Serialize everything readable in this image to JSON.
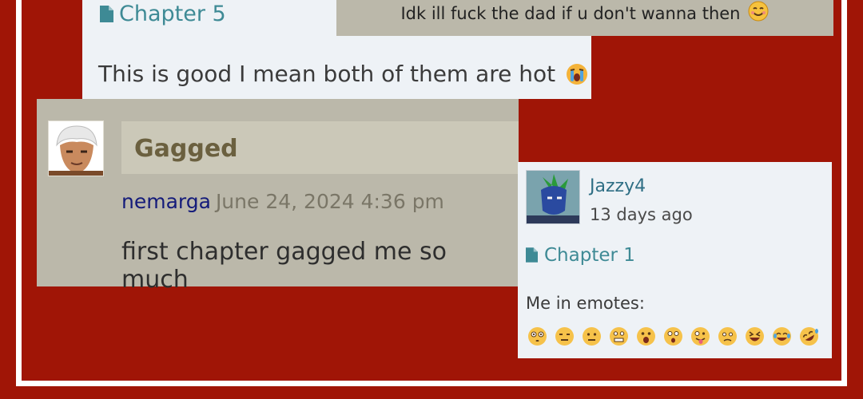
{
  "card_top_left": {
    "chapter_label": "Chapter 5",
    "comment": "This is good I mean both of them are hot",
    "emoji": "loudly-crying-face"
  },
  "card_top_right": {
    "comment": "Idk ill fuck the dad if u don't wanna then",
    "emoji": "smiling-face"
  },
  "card_middle": {
    "title": "Gagged",
    "author": "nemarga",
    "date": "June 24, 2024 4:36 pm",
    "comment": "first chapter gagged me so much"
  },
  "card_right": {
    "username": "Jazzy4",
    "time_ago": "13 days ago",
    "chapter_label": "Chapter 1",
    "comment": "Me in emotes:",
    "emotes": [
      "flushed",
      "expressionless",
      "neutral",
      "grimacing",
      "astonished",
      "open-mouth",
      "tongue",
      "worried",
      "squinting-laugh",
      "tears-of-joy",
      "rofl"
    ]
  },
  "colors": {
    "background": "#a01506",
    "frame": "#ffffff",
    "light_card": "#eef2f6",
    "khaki_card": "#bbb8aa",
    "link_teal": "#3e8a95",
    "author_navy": "#141b7a",
    "title_olive": "#6b603f"
  }
}
